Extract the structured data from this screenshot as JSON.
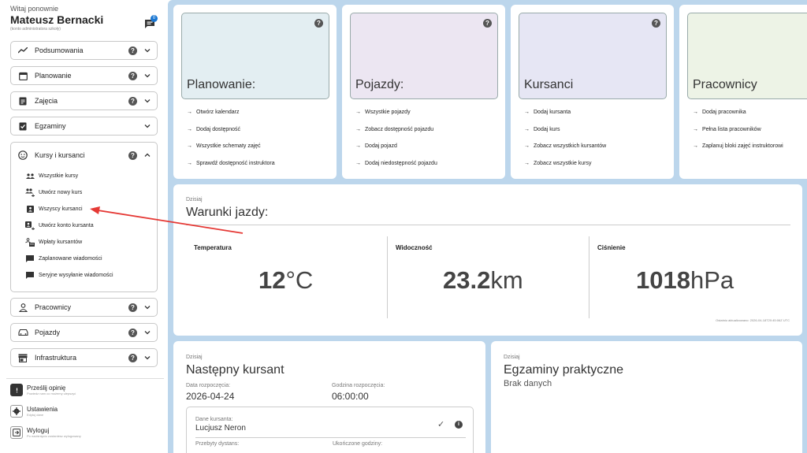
{
  "user": {
    "greeting": "Witaj ponownie",
    "name": "Mateusz Bernacki",
    "account_note": "(konto administratora szkoły)",
    "messages_badge": "0"
  },
  "sidebar": {
    "items": [
      {
        "label": "Podsumowania",
        "icon": "trend-icon",
        "help": "?"
      },
      {
        "label": "Planowanie",
        "icon": "calendar-icon",
        "help": "?"
      },
      {
        "label": "Zajęcia",
        "icon": "clipboard-icon",
        "help": "?"
      },
      {
        "label": "Egzaminy",
        "icon": "check-clipboard-icon"
      },
      {
        "label": "Kursy i kursanci",
        "icon": "face-icon",
        "help": "?"
      },
      {
        "label": "Pracownicy",
        "icon": "person-icon",
        "help": "?"
      },
      {
        "label": "Pojazdy",
        "icon": "car-icon",
        "help": "?"
      },
      {
        "label": "Infrastruktura",
        "icon": "store-icon",
        "help": "?"
      }
    ],
    "sub_items": [
      {
        "label": "Wszystkie kursy"
      },
      {
        "label": "Utwórz nowy kurs"
      },
      {
        "label": "Wszyscy kursanci"
      },
      {
        "label": "Utwórz konto kursanta"
      },
      {
        "label": "Wpłaty kursantów"
      },
      {
        "label": "Zaplanowane wiadomości"
      },
      {
        "label": "Seryjne wysyłanie wiadomości"
      }
    ],
    "bottom": {
      "feedback_title": "Prześlij opinię",
      "feedback_sub": "Powiedz nam co możemy ulepszyć",
      "settings_title": "Ustawienia",
      "settings_sub": "Edytuj dane",
      "logout_title": "Wyloguj",
      "logout_sub": "Po naciśnięciu zostaniesz wylogowany"
    }
  },
  "quick_cards": [
    {
      "title": "Planowanie:",
      "color": "#e3eef2",
      "links": [
        "Otwórz kalendarz",
        "Dodaj dostępność",
        "Wszystkie schematy zajęć",
        "Sprawdź dostępność instruktora"
      ]
    },
    {
      "title": "Pojazdy:",
      "color": "#ece6f2",
      "links": [
        "Wszystkie pojazdy",
        "Zobacz dostępność pojazdu",
        "Dodaj pojazd",
        "Dodaj niedostępność pojazdu"
      ]
    },
    {
      "title": "Kursanci",
      "color": "#e6e6f4",
      "links": [
        "Dodaj kursanta",
        "Dodaj kurs",
        "Zobacz wszystkich kursantów",
        "Zobacz wszystkie kursy"
      ]
    },
    {
      "title": "Pracownicy",
      "color": "#edf3e6",
      "links": [
        "Dodaj pracownika",
        "Pełna lista pracowników",
        "Zaplanuj bloki zajęć instruktorowi"
      ]
    }
  ],
  "weather": {
    "today": "Dzisiaj",
    "title": "Warunki jazdy:",
    "temp_label": "Temperatura",
    "temp_value": "12",
    "temp_unit": "°C",
    "vis_label": "Widoczność",
    "vis_value": "23.2",
    "vis_unit": "km",
    "press_label": "Ciśnienie",
    "press_value": "1018",
    "press_unit": "hPa",
    "updated": "Ostatnio aktualizowano: 2026-04-18T20:45:06Z UTC"
  },
  "next_student": {
    "today": "Dzisiaj",
    "title": "Następny kursant",
    "start_date_label": "Data rozpoczęcia:",
    "start_date": "2026-04-24",
    "start_time_label": "Godzina rozpoczęcia:",
    "start_time": "06:00:00",
    "details_label": "Dane kursanta:",
    "student_name": "Lucjusz Neron",
    "distance_label": "Przebyty dystans:",
    "hours_label": "Ukończone godziny:"
  },
  "exams": {
    "today": "Dzisiaj",
    "title": "Egzaminy praktyczne",
    "empty": "Brak danych"
  },
  "colors": {
    "annotation_arrow": "#e53935",
    "main_bg": "#bcd6ec",
    "accent": "#1976d2"
  }
}
